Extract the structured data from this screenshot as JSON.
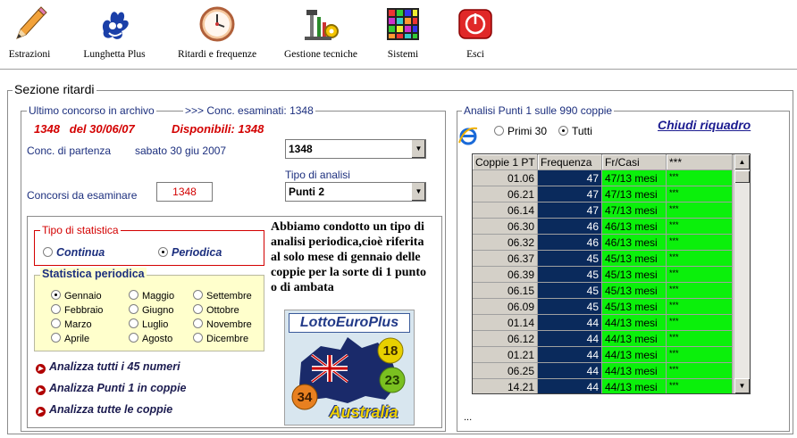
{
  "toolbar": [
    {
      "label": "Estrazioni",
      "icon": "pencil-icon"
    },
    {
      "label": "Lunghetta Plus",
      "icon": "lottery-hand-icon"
    },
    {
      "label": "Ritardi e frequenze",
      "icon": "clock-icon"
    },
    {
      "label": "Gestione tecniche",
      "icon": "tools-icon"
    },
    {
      "label": "Sistemi",
      "icon": "grid-icon"
    },
    {
      "label": "Esci",
      "icon": "power-icon"
    }
  ],
  "section": {
    "title": "Sezione ritardi",
    "archive_legend": "Ultimo concorso in archivo",
    "examined_label": ">>> Conc. esaminati: 1348",
    "last_draw": "1348   del 30/06/07",
    "available": "Disponibili: 1348",
    "start_label": "Conc. di partenza",
    "start_date": "sabato 30 giu 2007",
    "start_value": "1348",
    "analysis_type_label": "Tipo di analisi",
    "analysis_type_value": "Punti 2",
    "to_examine_label": "Concorsi da esaminare",
    "to_examine_value": "1348"
  },
  "stat": {
    "type_legend": "Tipo di statistica",
    "continua": "Continua",
    "periodica": "Periodica",
    "selected": "periodica",
    "periodic_legend": "Statistica periodica",
    "months": [
      "Gennaio",
      "Febbraio",
      "Marzo",
      "Aprile",
      "Maggio",
      "Giugno",
      "Luglio",
      "Agosto",
      "Settembre",
      "Ottobre",
      "Novembre",
      "Dicembre"
    ],
    "selected_month": "Gennaio"
  },
  "note": "Abbiamo condotto un tipo di analisi periodica,cioè riferita al solo mese di gennaio delle coppie per la sorte di 1 punto o di ambata",
  "logo": {
    "top": "LottoEuroPlus",
    "bottom": "Australia",
    "balls": [
      "18",
      "23",
      "34"
    ]
  },
  "actions": [
    "Analizza tutti i 45 numeri",
    "Analizza Punti 1 in coppie",
    "Analizza tutte le coppie"
  ],
  "panel": {
    "legend": "Analisi Punti 1 sulle 990 coppie",
    "close_link": "Chiudi riquadro",
    "radio_first": "Primi 30",
    "radio_all": "Tutti",
    "selected": "Tutti",
    "ellipsis": "...",
    "columns": [
      "Coppie 1 PT",
      "Frequenza",
      "Fr/Casi",
      "***"
    ],
    "rows": [
      [
        "01.06",
        "47",
        "47/13 mesi",
        "***"
      ],
      [
        "06.21",
        "47",
        "47/13 mesi",
        "***"
      ],
      [
        "06.14",
        "47",
        "47/13 mesi",
        "***"
      ],
      [
        "06.30",
        "46",
        "46/13 mesi",
        "***"
      ],
      [
        "06.32",
        "46",
        "46/13 mesi",
        "***"
      ],
      [
        "06.37",
        "45",
        "45/13 mesi",
        "***"
      ],
      [
        "06.39",
        "45",
        "45/13 mesi",
        "***"
      ],
      [
        "06.15",
        "45",
        "45/13 mesi",
        "***"
      ],
      [
        "06.09",
        "45",
        "45/13 mesi",
        "***"
      ],
      [
        "01.14",
        "44",
        "44/13 mesi",
        "***"
      ],
      [
        "06.12",
        "44",
        "44/13 mesi",
        "***"
      ],
      [
        "01.21",
        "44",
        "44/13 mesi",
        "***"
      ],
      [
        "06.25",
        "44",
        "44/13 mesi",
        "***"
      ],
      [
        "14.21",
        "44",
        "44/13 mesi",
        "***"
      ]
    ]
  },
  "colors": {
    "freq_bg": "#0a2a5c",
    "casi_bg": "#0bf00b",
    "stats_bg": "#ffffcc",
    "accent_red": "#d30000"
  }
}
